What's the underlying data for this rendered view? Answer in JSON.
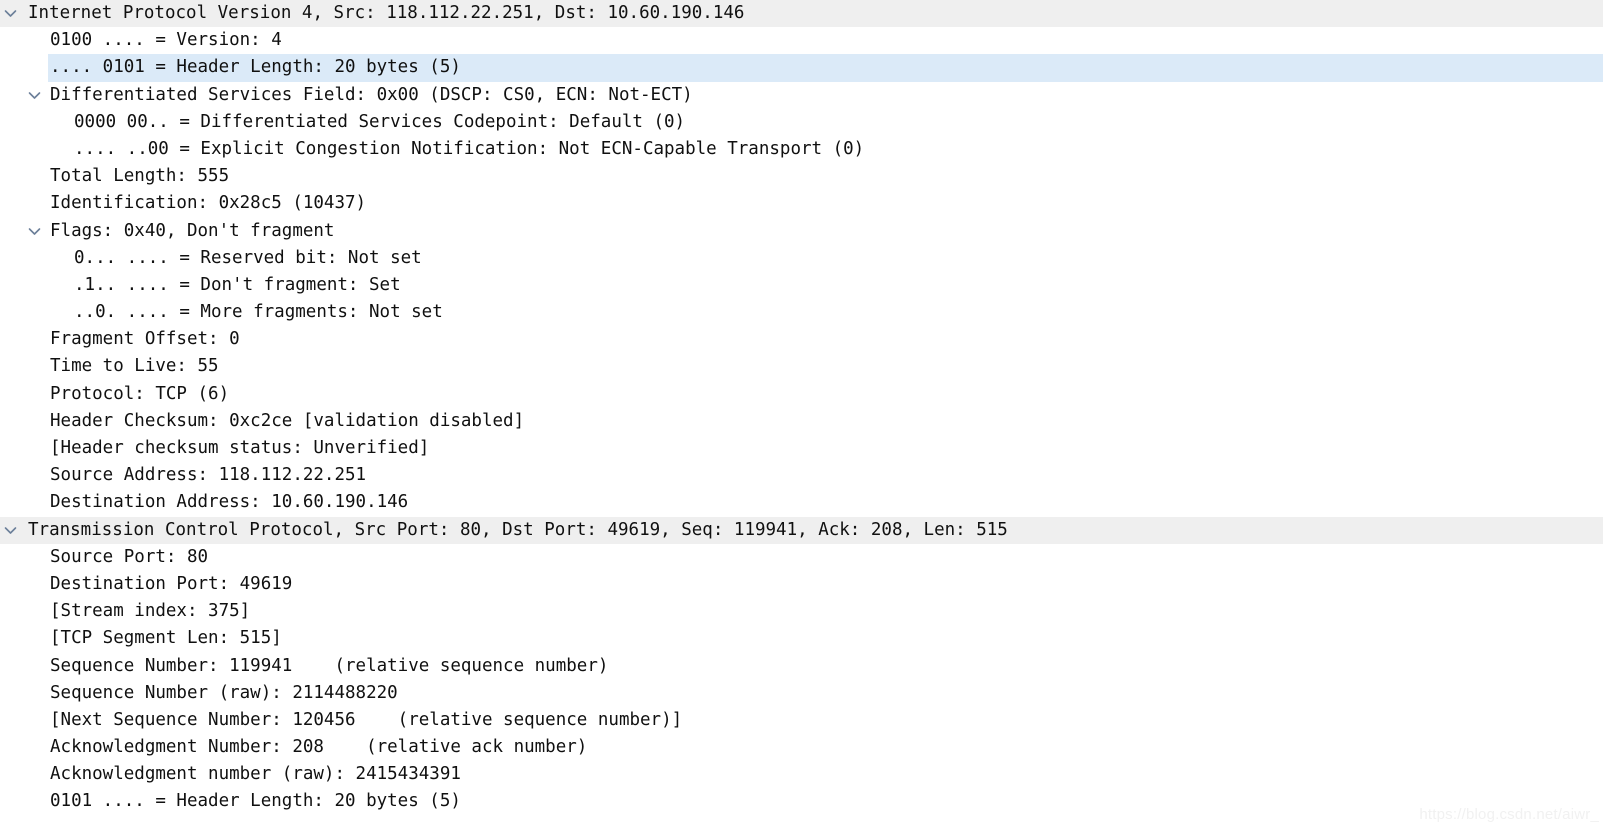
{
  "panel": {
    "name": "wireshark-packet-details",
    "selected_row_index": 2,
    "colors": {
      "background": "#ffffff",
      "protocol_row_background": "#efefef",
      "selected_row_background": "#dbeaf8",
      "text": "#101010",
      "chevron": "#6b7f99",
      "watermark": "#f1f1f1"
    }
  },
  "watermark": {
    "text": "https://blog.csdn.net/aiwr_"
  },
  "rows": [
    {
      "level": 0,
      "expander": "chevron-down",
      "protocol": true,
      "selected": false,
      "text": "Internet Protocol Version 4, Src: 118.112.22.251, Dst: 10.60.190.146"
    },
    {
      "level": 1,
      "expander": "none",
      "protocol": false,
      "selected": false,
      "text": "0100 .... = Version: 4"
    },
    {
      "level": 1,
      "expander": "none",
      "protocol": false,
      "selected": true,
      "text": ".... 0101 = Header Length: 20 bytes (5)"
    },
    {
      "level": 1,
      "expander": "chevron-down",
      "protocol": false,
      "selected": false,
      "text": "Differentiated Services Field: 0x00 (DSCP: CS0, ECN: Not-ECT)"
    },
    {
      "level": 2,
      "expander": "none",
      "protocol": false,
      "selected": false,
      "text": "0000 00.. = Differentiated Services Codepoint: Default (0)"
    },
    {
      "level": 2,
      "expander": "none",
      "protocol": false,
      "selected": false,
      "text": ".... ..00 = Explicit Congestion Notification: Not ECN-Capable Transport (0)"
    },
    {
      "level": 1,
      "expander": "none",
      "protocol": false,
      "selected": false,
      "text": "Total Length: 555"
    },
    {
      "level": 1,
      "expander": "none",
      "protocol": false,
      "selected": false,
      "text": "Identification: 0x28c5 (10437)"
    },
    {
      "level": 1,
      "expander": "chevron-down",
      "protocol": false,
      "selected": false,
      "text": "Flags: 0x40, Don't fragment"
    },
    {
      "level": 2,
      "expander": "none",
      "protocol": false,
      "selected": false,
      "text": "0... .... = Reserved bit: Not set"
    },
    {
      "level": 2,
      "expander": "none",
      "protocol": false,
      "selected": false,
      "text": ".1.. .... = Don't fragment: Set"
    },
    {
      "level": 2,
      "expander": "none",
      "protocol": false,
      "selected": false,
      "text": "..0. .... = More fragments: Not set"
    },
    {
      "level": 1,
      "expander": "none",
      "protocol": false,
      "selected": false,
      "text": "Fragment Offset: 0"
    },
    {
      "level": 1,
      "expander": "none",
      "protocol": false,
      "selected": false,
      "text": "Time to Live: 55"
    },
    {
      "level": 1,
      "expander": "none",
      "protocol": false,
      "selected": false,
      "text": "Protocol: TCP (6)"
    },
    {
      "level": 1,
      "expander": "none",
      "protocol": false,
      "selected": false,
      "text": "Header Checksum: 0xc2ce [validation disabled]"
    },
    {
      "level": 1,
      "expander": "none",
      "protocol": false,
      "selected": false,
      "text": "[Header checksum status: Unverified]"
    },
    {
      "level": 1,
      "expander": "none",
      "protocol": false,
      "selected": false,
      "text": "Source Address: 118.112.22.251"
    },
    {
      "level": 1,
      "expander": "none",
      "protocol": false,
      "selected": false,
      "text": "Destination Address: 10.60.190.146"
    },
    {
      "level": 0,
      "expander": "chevron-down",
      "protocol": true,
      "selected": false,
      "text": "Transmission Control Protocol, Src Port: 80, Dst Port: 49619, Seq: 119941, Ack: 208, Len: 515"
    },
    {
      "level": 1,
      "expander": "none",
      "protocol": false,
      "selected": false,
      "text": "Source Port: 80"
    },
    {
      "level": 1,
      "expander": "none",
      "protocol": false,
      "selected": false,
      "text": "Destination Port: 49619"
    },
    {
      "level": 1,
      "expander": "none",
      "protocol": false,
      "selected": false,
      "text": "[Stream index: 375]"
    },
    {
      "level": 1,
      "expander": "none",
      "protocol": false,
      "selected": false,
      "text": "[TCP Segment Len: 515]"
    },
    {
      "level": 1,
      "expander": "none",
      "protocol": false,
      "selected": false,
      "text": "Sequence Number: 119941    (relative sequence number)"
    },
    {
      "level": 1,
      "expander": "none",
      "protocol": false,
      "selected": false,
      "text": "Sequence Number (raw): 2114488220"
    },
    {
      "level": 1,
      "expander": "none",
      "protocol": false,
      "selected": false,
      "text": "[Next Sequence Number: 120456    (relative sequence number)]"
    },
    {
      "level": 1,
      "expander": "none",
      "protocol": false,
      "selected": false,
      "text": "Acknowledgment Number: 208    (relative ack number)"
    },
    {
      "level": 1,
      "expander": "none",
      "protocol": false,
      "selected": false,
      "text": "Acknowledgment number (raw): 2415434391"
    },
    {
      "level": 1,
      "expander": "none",
      "protocol": false,
      "selected": false,
      "text": "0101 .... = Header Length: 20 bytes (5)"
    }
  ]
}
